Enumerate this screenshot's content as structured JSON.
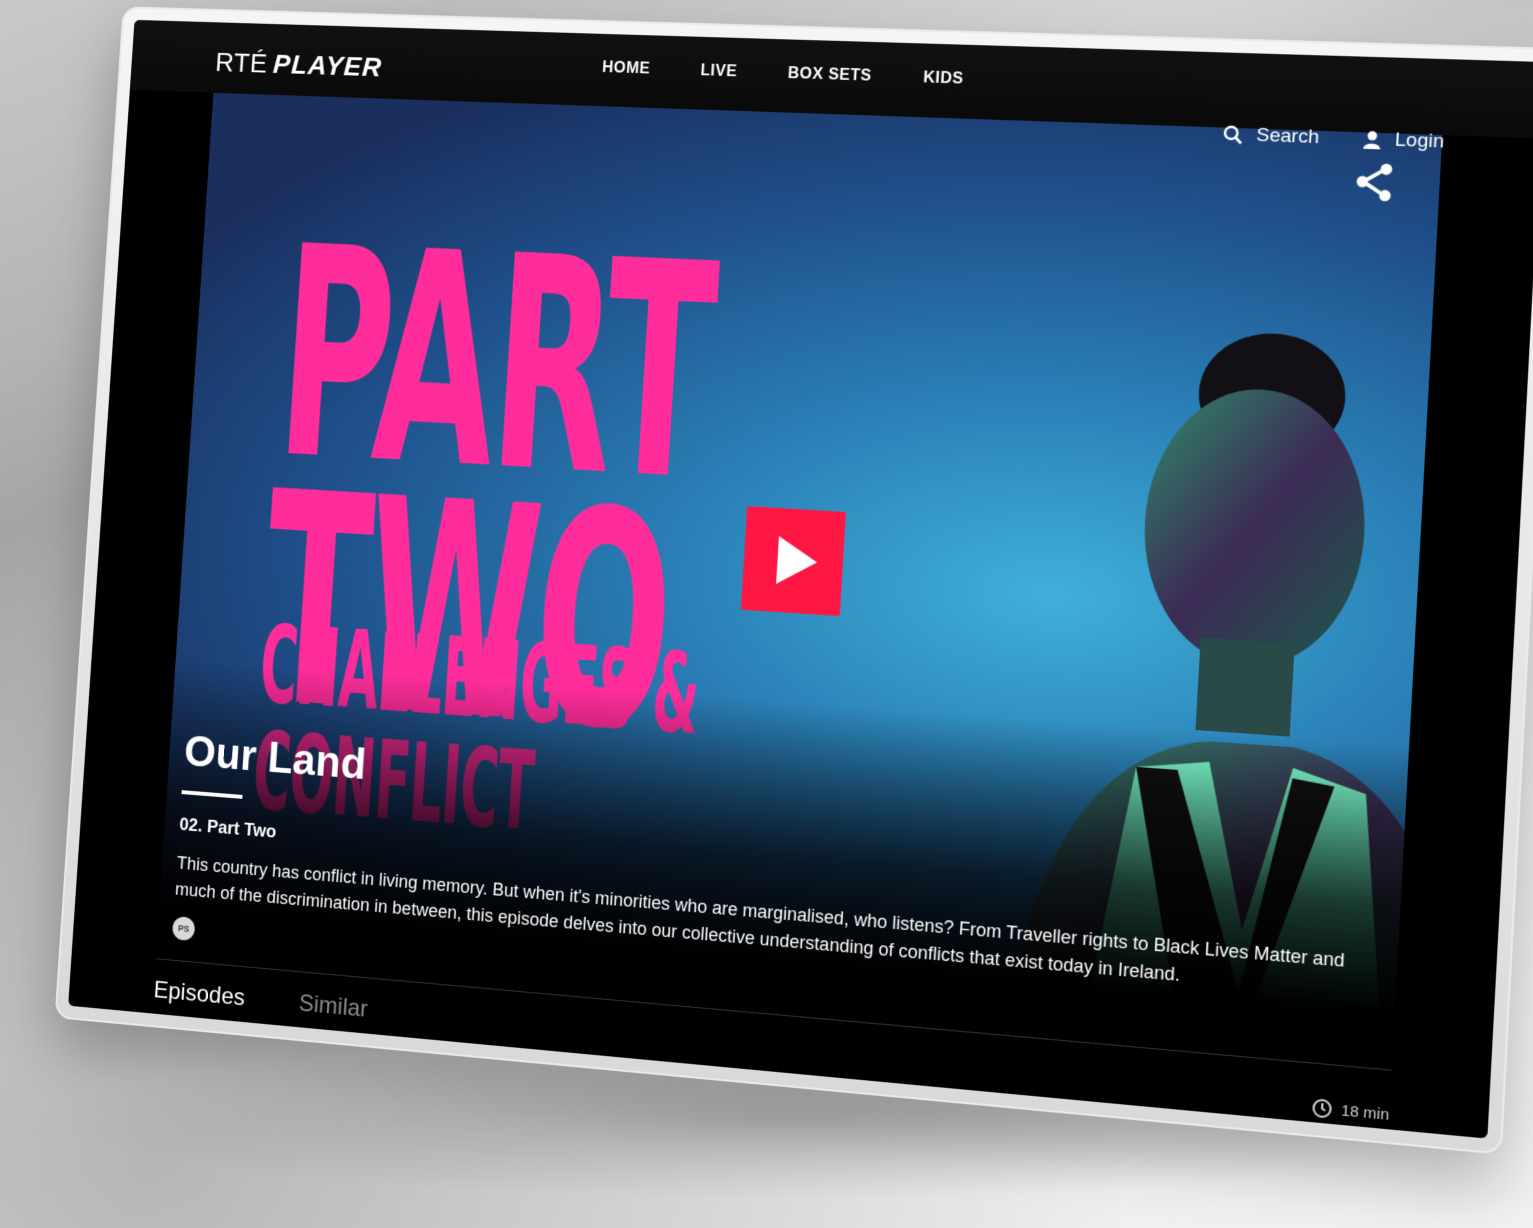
{
  "app": {
    "logo_rte": "RTÉ",
    "logo_player": "PLAYER"
  },
  "nav": {
    "items": [
      {
        "label": "HOME"
      },
      {
        "label": "LIVE"
      },
      {
        "label": "BOX SETS"
      },
      {
        "label": "KIDS"
      }
    ]
  },
  "header_actions": {
    "search_label": "Search",
    "login_label": "Login"
  },
  "hero": {
    "art_title": "PART TWO",
    "art_subtitle": "CHALLENGES & CONFLICT",
    "play_icon": "play-icon",
    "share_icon": "share-icon"
  },
  "details": {
    "show_title": "Our Land",
    "episode_name": "02. Part Two",
    "description": "This country has conflict in living memory. But when it's minorities who are marginalised, who listens? From Traveller rights to Black Lives Matter and much of the discrimination in between, this episode delves into our collective understanding of conflicts that exist today in Ireland.",
    "rating_badge": "PS",
    "duration": "18 min"
  },
  "tabs": [
    {
      "label": "Episodes"
    },
    {
      "label": "Similar"
    }
  ],
  "colors": {
    "accent_pink": "#ff2d9b",
    "play_red": "#ff1744",
    "background": "#000000"
  }
}
